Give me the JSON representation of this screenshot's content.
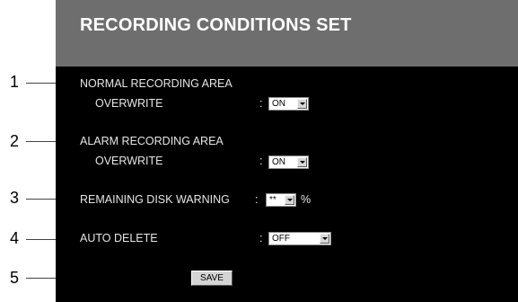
{
  "header": {
    "title": "RECORDING CONDITIONS SET"
  },
  "settings": {
    "normal": {
      "label": "NORMAL RECORDING AREA",
      "sub_label": "OVERWRITE",
      "colon": ":",
      "value": "ON"
    },
    "alarm": {
      "label": "ALARM RECORDING AREA",
      "sub_label": "OVERWRITE",
      "colon": ":",
      "value": "ON"
    },
    "warning": {
      "label": "REMAINING DISK WARNING",
      "colon": ":",
      "value": "**",
      "unit": "%"
    },
    "auto_delete": {
      "label": "AUTO DELETE",
      "colon": ":",
      "value": "OFF"
    }
  },
  "save_label": "SAVE",
  "callouts": [
    "1",
    "2",
    "3",
    "4",
    "5"
  ]
}
